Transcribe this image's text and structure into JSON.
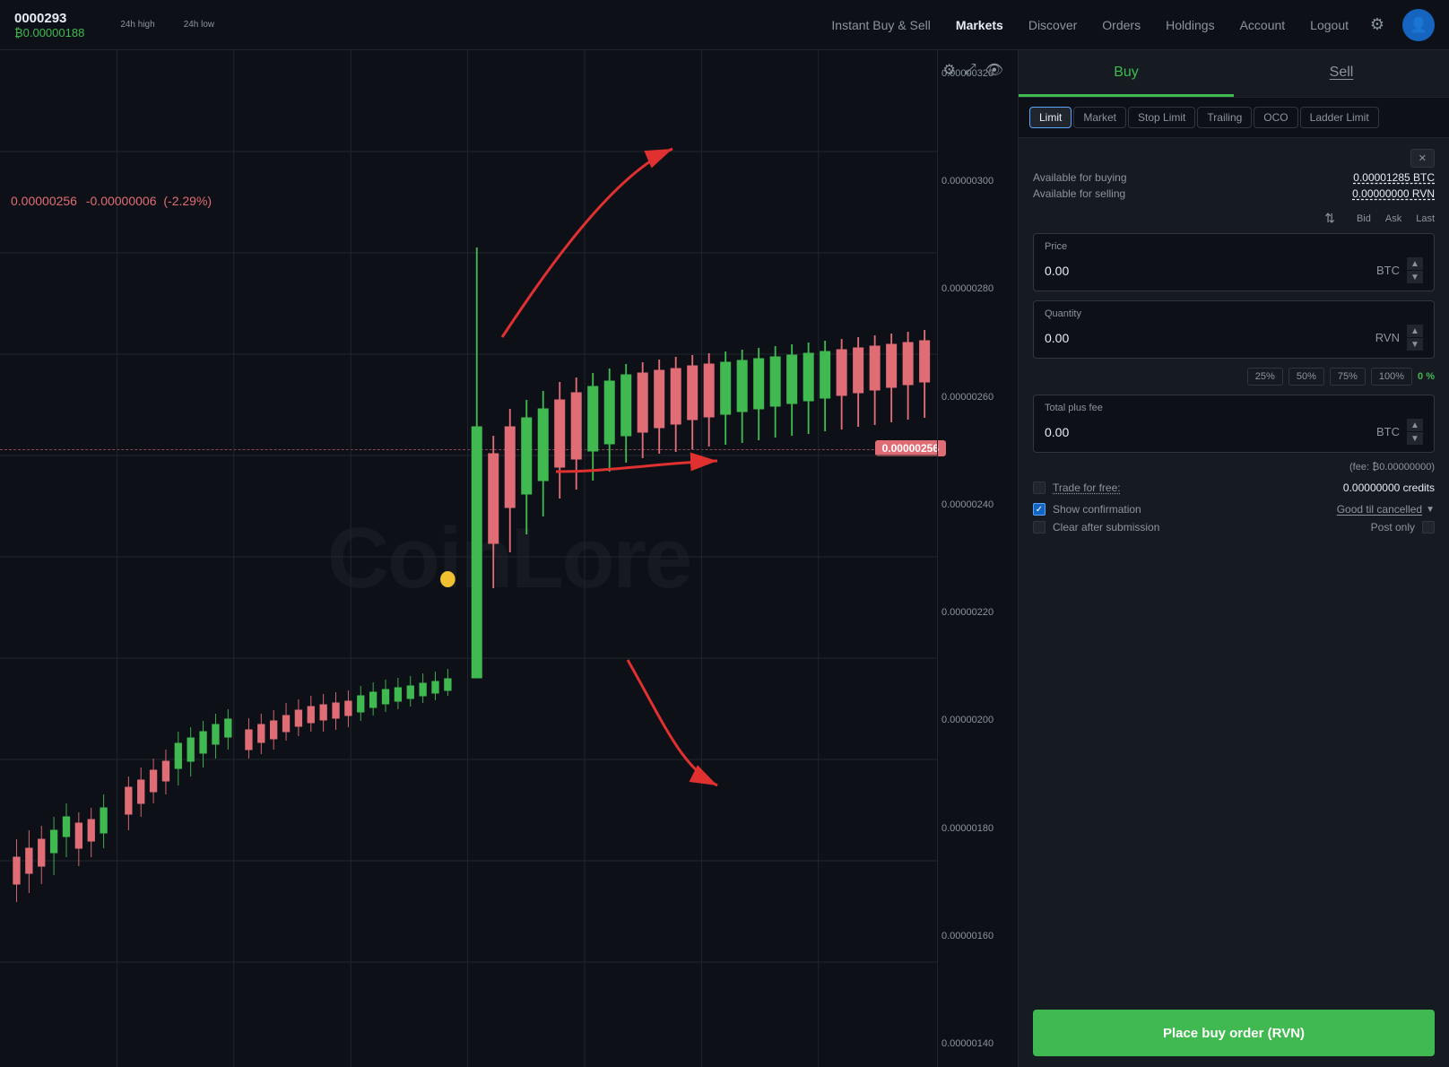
{
  "topnav": {
    "pair": "0000293",
    "price_btc": "₿0.00000188",
    "high_label": "24h high",
    "low_label": "24h low",
    "nav_links": [
      {
        "label": "Instant Buy & Sell",
        "active": false
      },
      {
        "label": "Markets",
        "active": true
      },
      {
        "label": "Discover",
        "active": false
      },
      {
        "label": "Orders",
        "active": false
      },
      {
        "label": "Holdings",
        "active": false
      },
      {
        "label": "Account",
        "active": false
      },
      {
        "label": "Logout",
        "active": false
      }
    ]
  },
  "chart": {
    "price_change": "0.00000256",
    "price_diff": "-0.00000006",
    "price_pct": "(-2.29%)",
    "current_price": "0.00000256",
    "y_axis_labels": [
      "0.00000320",
      "0.00000300",
      "0.00000280",
      "0.00000260",
      "0.00000240",
      "0.00000220",
      "0.00000200",
      "0.00000180",
      "0.00000160",
      "0.00000140"
    ],
    "watermark": "CoinLore"
  },
  "order_panel": {
    "tab_buy": "Buy",
    "tab_sell": "Sell",
    "order_types": [
      "Limit",
      "Market",
      "Stop Limit",
      "Trailing",
      "OCO",
      "Ladder Limit"
    ],
    "active_type": "Limit",
    "available_buying_label": "Available for buying",
    "available_buying_val": "0.00001285 BTC",
    "available_selling_label": "Available for selling",
    "available_selling_val": "0.00000000 RVN",
    "bid_label": "Bid",
    "ask_label": "Ask",
    "last_label": "Last",
    "price_label": "Price",
    "price_val": "0.00",
    "price_currency": "BTC",
    "quantity_label": "Quantity",
    "quantity_val": "0.00",
    "quantity_currency": "RVN",
    "pct_buttons": [
      "25%",
      "50%",
      "75%",
      "100%"
    ],
    "pct_current": "0 %",
    "total_label": "Total plus fee",
    "total_val": "0.00",
    "total_currency": "BTC",
    "fee_label": "(fee: ₿0.00000000)",
    "trade_free_label": "Trade for free:",
    "credits_val": "0.00000000 credits",
    "show_confirmation_label": "Show confirmation",
    "gtc_label": "Good til cancelled",
    "clear_submission_label": "Clear after submission",
    "post_only_label": "Post only",
    "place_order_btn": "Place buy order (RVN)"
  }
}
